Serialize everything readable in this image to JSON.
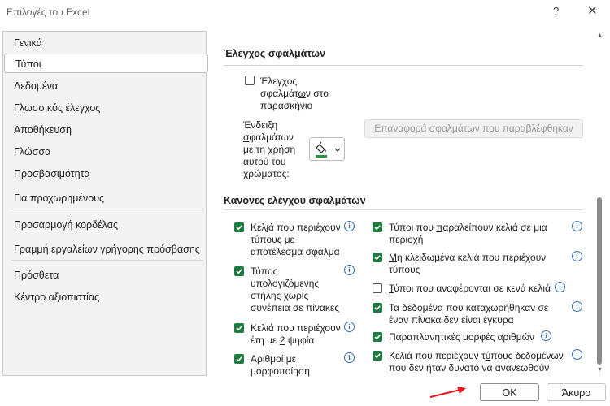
{
  "window": {
    "title": "Επιλογές του Excel",
    "help": "?",
    "close": "✕"
  },
  "sidebar": {
    "items": [
      {
        "label": "Γενικά"
      },
      {
        "label": "Τύποι"
      },
      {
        "label": "Δεδομένα"
      },
      {
        "label": "Γλωσσικός έλεγχος"
      },
      {
        "label": "Αποθήκευση"
      },
      {
        "label": "Γλώσσα"
      },
      {
        "label": "Προσβασιμότητα"
      },
      {
        "label": "Για προχωρημένους"
      },
      {
        "label": "Προσαρμογή κορδέλας"
      },
      {
        "label": "Γραμμή εργαλείων γρήγορης πρόσβασης"
      },
      {
        "label": "Πρόσθετα"
      },
      {
        "label": "Κέντρο αξιοπιστίας"
      }
    ],
    "selected": "Τύποι"
  },
  "error_checking": {
    "title": "Έλεγχος σφαλμάτων",
    "bg_check_label_1": "Έλεγχος",
    "bg_check_label_2a": "σφαλμάτ",
    "bg_check_label_2u": "ω",
    "bg_check_label_2b": "ν στο",
    "bg_check_label_3": "παρασκήνιο",
    "bg_check_checked": false,
    "color_label_1": "Ένδειξη",
    "color_label_2a": "",
    "color_label_2u": "σ",
    "color_label_2b": "φαλμάτων",
    "color_label_3": "με τη χρήση",
    "color_label_4": "αυτού του",
    "color_label_5": "χρώματος:",
    "color_value": "#1f9c3a",
    "reset_button": "Επαναφορά σφαλμάτων που παραβλέφθηκαν"
  },
  "rules": {
    "title": "Κανόνες ελέγχου σφαλμάτων",
    "left": [
      {
        "lines": [
          "Κελ|ι|ά που περιέχουν",
          "τύπους με",
          "αποτέλεσμα σφάλμα"
        ],
        "checked": true
      },
      {
        "lines": [
          "Τύπος",
          "υπολογιζόμενης",
          "στήλης χωρίς",
          "συνέπεια σε πίνακες"
        ],
        "checked": true
      },
      {
        "lines": [
          "Κελιά που περιέχουν",
          "έτη με |2| ψηφία"
        ],
        "checked": true
      },
      {
        "lines": [
          "Αριθμοί με",
          "μορφοποίηση"
        ],
        "checked": true
      }
    ],
    "right": [
      {
        "lines": [
          "Τύποι που |π|αραλείπουν κελιά σε μια",
          "περιοχή"
        ],
        "checked": true
      },
      {
        "lines": [
          "|Μ|η κλειδωμένα κελιά που περιέχουν",
          "τύπους"
        ],
        "checked": true
      },
      {
        "lines": [
          "|Τ|ύποι που αναφέρονται σε κενά κελιά"
        ],
        "checked": false
      },
      {
        "lines": [
          "Τα δεδομένα που καταχωρήθηκαν σε",
          "έναν πίνακα δεν είναι έγκυρα"
        ],
        "checked": true
      },
      {
        "lines": [
          "Παραπλανητικές μορφές αριθμών"
        ],
        "checked": true
      },
      {
        "lines": [
          "Κελιά που περιέχουν τ|ύ|πους δεδομένων",
          "που δεν ήταν δυνατό να ανανεωθούν"
        ],
        "checked": true
      }
    ]
  },
  "footer": {
    "ok": "OK",
    "cancel": "Άκυρο"
  },
  "colors": {
    "accent": "#1f7a3f",
    "info": "#2f6db5",
    "arrow": "#e8141a"
  }
}
